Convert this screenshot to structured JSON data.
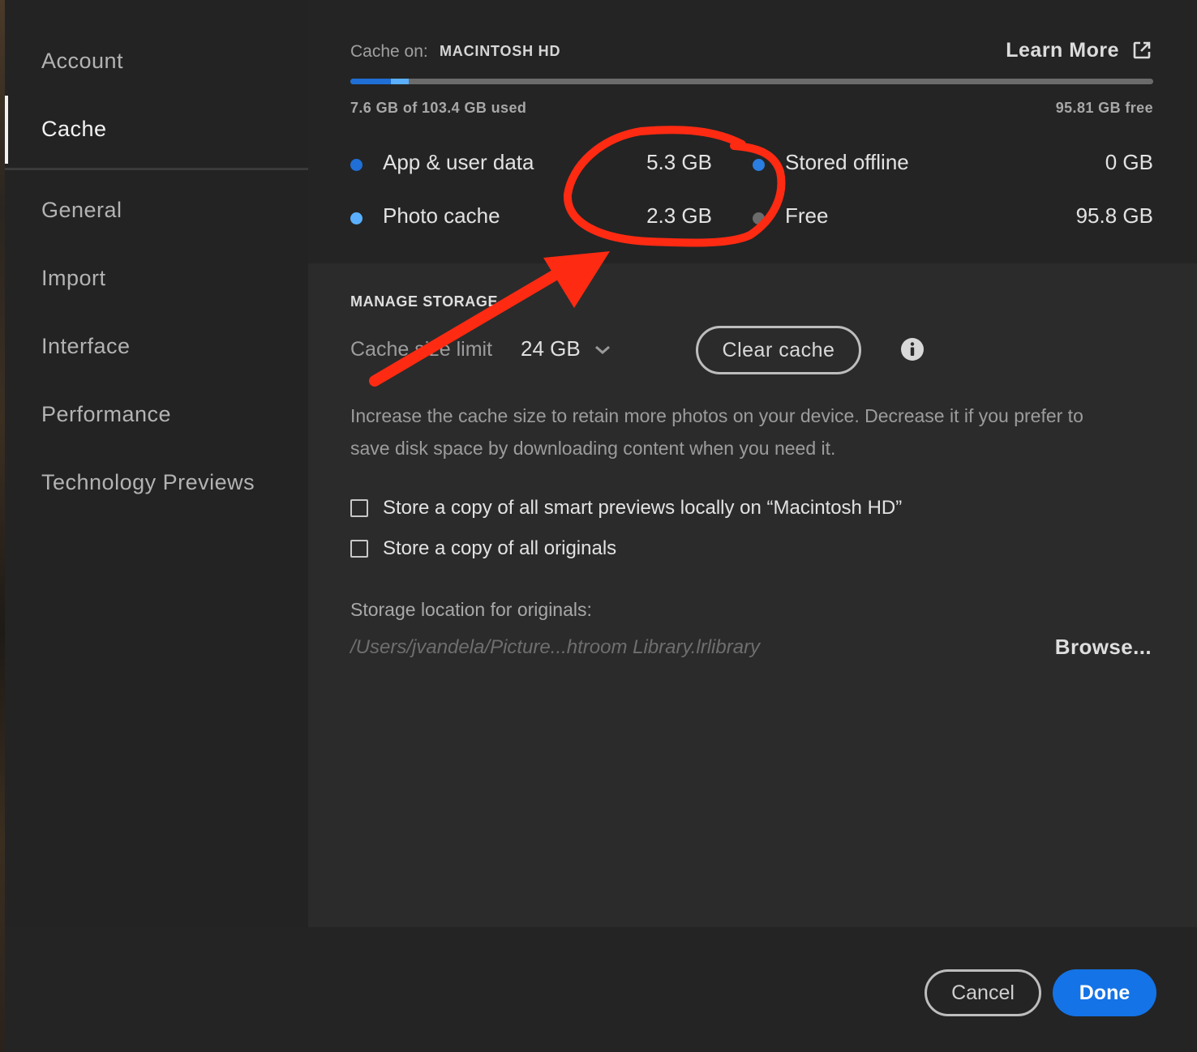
{
  "sidebar": {
    "items": [
      {
        "label": "Account"
      },
      {
        "label": "Cache",
        "active": true
      },
      {
        "label": "General"
      },
      {
        "label": "Import"
      },
      {
        "label": "Interface"
      },
      {
        "label": "Performance"
      },
      {
        "label": "Technology Previews"
      }
    ]
  },
  "storage": {
    "cache_on_label": "Cache on:",
    "cache_on_value": "MACINTOSH HD",
    "learn_more": "Learn More",
    "used_text": "7.6 GB of 103.4 GB used",
    "free_text": "95.81 GB free",
    "usage_bar": {
      "app_user_data_fraction": 0.051,
      "photo_cache_fraction": 0.022
    },
    "legend": [
      {
        "label": "App & user data",
        "value": "5.3 GB",
        "color": "#1f6fd6"
      },
      {
        "label": "Photo cache",
        "value": "2.3 GB",
        "color": "#5ab0ff"
      },
      {
        "label": "Stored offline",
        "value": "0 GB",
        "color": "#2a7de1"
      },
      {
        "label": "Free",
        "value": "95.8 GB",
        "color": "#6b6b6b"
      }
    ]
  },
  "manage": {
    "heading": "MANAGE STORAGE",
    "limit_label": "Cache size limit",
    "limit_value": "24 GB",
    "clear_button": "Clear cache",
    "description": "Increase the cache size to retain more photos on your device. Decrease it if you prefer to save disk space by downloading content when you need it.",
    "checkbox_smart_previews": "Store a copy of all smart previews locally on “Macintosh HD”",
    "checkbox_originals": "Store a copy of all originals",
    "storage_location_label": "Storage location for originals:",
    "storage_path": "/Users/jvandela/Picture...htroom Library.lrlibrary",
    "browse_button": "Browse..."
  },
  "footer": {
    "cancel_button": "Cancel",
    "done_button": "Done"
  },
  "colors": {
    "accent": "#1473e6",
    "annotation": "#ff2a12"
  },
  "icons": [
    "external-link-icon",
    "chevron-down-icon",
    "info-icon",
    "checkbox-icon"
  ]
}
